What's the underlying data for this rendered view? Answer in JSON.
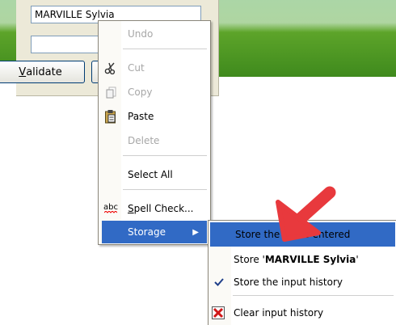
{
  "dialog": {
    "name_value": "MARVILLE Sylvia",
    "second_field_value": "",
    "validate_label": "Validate",
    "validate_mnemonic": "V"
  },
  "context_menu": {
    "items": [
      {
        "label": "Undo",
        "enabled": false,
        "icon": ""
      },
      {
        "label": "Cut",
        "enabled": false,
        "icon": "scissors-icon"
      },
      {
        "label": "Copy",
        "enabled": false,
        "icon": "copy-icon"
      },
      {
        "label": "Paste",
        "enabled": true,
        "icon": "paste-icon"
      },
      {
        "label": "Delete",
        "enabled": false,
        "icon": ""
      },
      {
        "label": "Select All",
        "enabled": true,
        "icon": ""
      },
      {
        "label": "Spell Check...",
        "enabled": true,
        "icon": "spellcheck-icon"
      },
      {
        "label": "Storage",
        "enabled": true,
        "icon": "",
        "submenu": true,
        "highlighted": true
      }
    ],
    "spell_icon_text": "abc"
  },
  "storage_submenu": {
    "items": [
      {
        "label": "Store the value entered",
        "highlighted": true,
        "icon": ""
      },
      {
        "label_prefix": "Store '",
        "label_bold": "MARVILLE Sylvia",
        "label_suffix": "'",
        "icon": ""
      },
      {
        "label": "Store the input history",
        "icon": "checkmark-icon",
        "checked": true
      },
      {
        "label": "Clear input history",
        "icon": "clear-icon"
      }
    ]
  },
  "colors": {
    "highlight": "#316ac5",
    "disabled_text": "#a7a7a7",
    "arrow_red": "#e8393d"
  }
}
